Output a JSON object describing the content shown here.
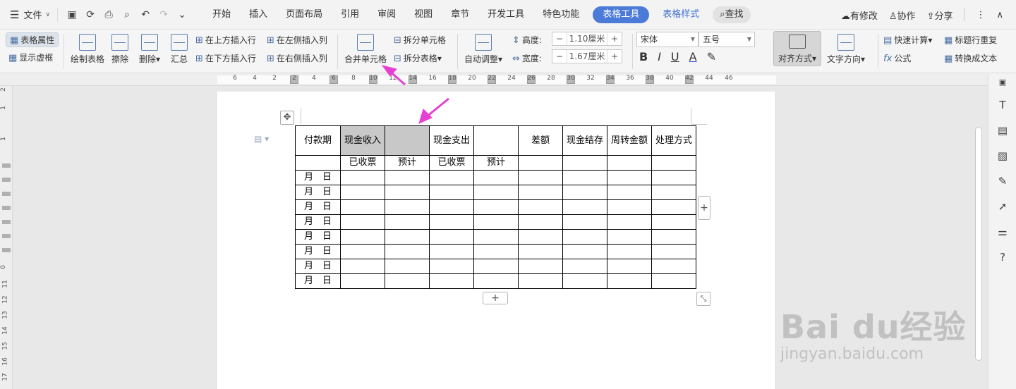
{
  "menubar": {
    "file_label": "文件",
    "tabs": [
      "开始",
      "插入",
      "页面布局",
      "引用",
      "审阅",
      "视图",
      "章节",
      "开发工具",
      "特色功能"
    ],
    "active_tab": "表格工具",
    "second_tab": "表格样式",
    "search_label": "查找",
    "right": {
      "revise": "有修改",
      "collab": "协作",
      "share": "分享"
    }
  },
  "ribbon": {
    "table_props": "表格属性",
    "show_grid": "显示虚框",
    "draw_table": "绘制表格",
    "erase": "擦除",
    "delete": "删除",
    "summary": "汇总",
    "insert_row_above": "在上方插入行",
    "insert_row_below": "在下方插入行",
    "insert_col_left": "在左侧插入列",
    "insert_col_right": "在右侧插入列",
    "merge_cells": "合并单元格",
    "split_cells": "拆分单元格",
    "split_table": "拆分表格",
    "auto_adjust": "自动调整",
    "height_label": "高度:",
    "height_value": "1.10厘米",
    "width_label": "宽度:",
    "width_value": "1.67厘米",
    "font_name": "宋体",
    "font_size": "五号",
    "align": "对齐方式",
    "text_dir": "文字方向",
    "quick_calc": "快速计算",
    "repeat_header": "标题行重复",
    "formula": "公式",
    "to_text": "转换成文本"
  },
  "ruler": {
    "h_ticks": [
      "6",
      "4",
      "2",
      "2",
      "4",
      "6",
      "8",
      "10",
      "12",
      "14",
      "16",
      "18",
      "20",
      "22",
      "24",
      "26",
      "28",
      "30",
      "32",
      "34",
      "36",
      "38",
      "40",
      "42",
      "44",
      "46"
    ],
    "v_ticks": [
      "2",
      "1",
      "1",
      "0",
      "11",
      "12",
      "13",
      "14",
      "15",
      "16",
      "17"
    ]
  },
  "table": {
    "header_row1": [
      "付款期",
      "现金收入",
      "",
      "现金支出",
      "",
      "差额",
      "现金结存",
      "周转金额",
      "处理方式"
    ],
    "header_row2": [
      "",
      "已收票",
      "预计",
      "已收票",
      "预计",
      "",
      "",
      "",
      ""
    ],
    "date_label": "月　日",
    "data_row_count": 8
  },
  "watermark": {
    "brand": "Bai du经验",
    "url": "jingyan.baidu.com"
  },
  "colors": {
    "accent": "#4b7ad8",
    "arrow": "#e53fd4",
    "shade": "#c8c8c8"
  }
}
